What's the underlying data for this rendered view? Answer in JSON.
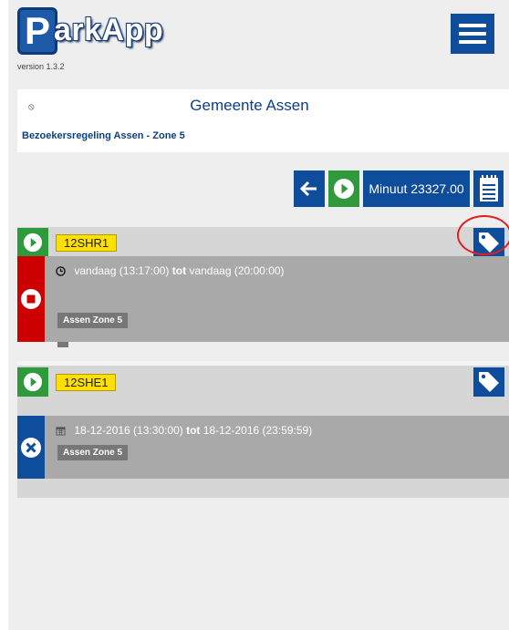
{
  "app": {
    "name_initial": "P",
    "name_rest": "arkApp",
    "version": "version 1.3.2"
  },
  "header": {
    "menu_icon": "hamburger-icon"
  },
  "location": {
    "icon": "pin-icon",
    "title": "Gemeente Assen",
    "subtitle": "Bezoekersregeling Assen - Zone 5"
  },
  "toolbar": {
    "back_icon": "arrow-left-icon",
    "play_icon": "play-icon",
    "minuut_label": "Minuut 23327.00",
    "notes_icon": "notes-icon"
  },
  "vehicles": [
    {
      "plate": "12SHR1",
      "session": {
        "status_icon": "stop-icon",
        "status_color": "#cc0000",
        "time_icon": "clock-icon",
        "from": "vandaag (13:17:00)",
        "tot": "tot",
        "to": "vandaag (20:00:00)",
        "zone": "Assen Zone 5"
      }
    },
    {
      "plate": "12SHE1",
      "session": {
        "status_icon": "cancel-icon",
        "status_color": "#0e4c9c",
        "time_icon": "calendar-icon",
        "from": "18-12-2016 (13:30:00)",
        "tot": "tot",
        "to": "18-12-2016 (23:59:59)",
        "zone": "Assen Zone 5"
      }
    }
  ],
  "colors": {
    "primary": "#0e4c9c",
    "green": "#2e9a3c",
    "red": "#cc0000",
    "plate": "#ffe000"
  }
}
